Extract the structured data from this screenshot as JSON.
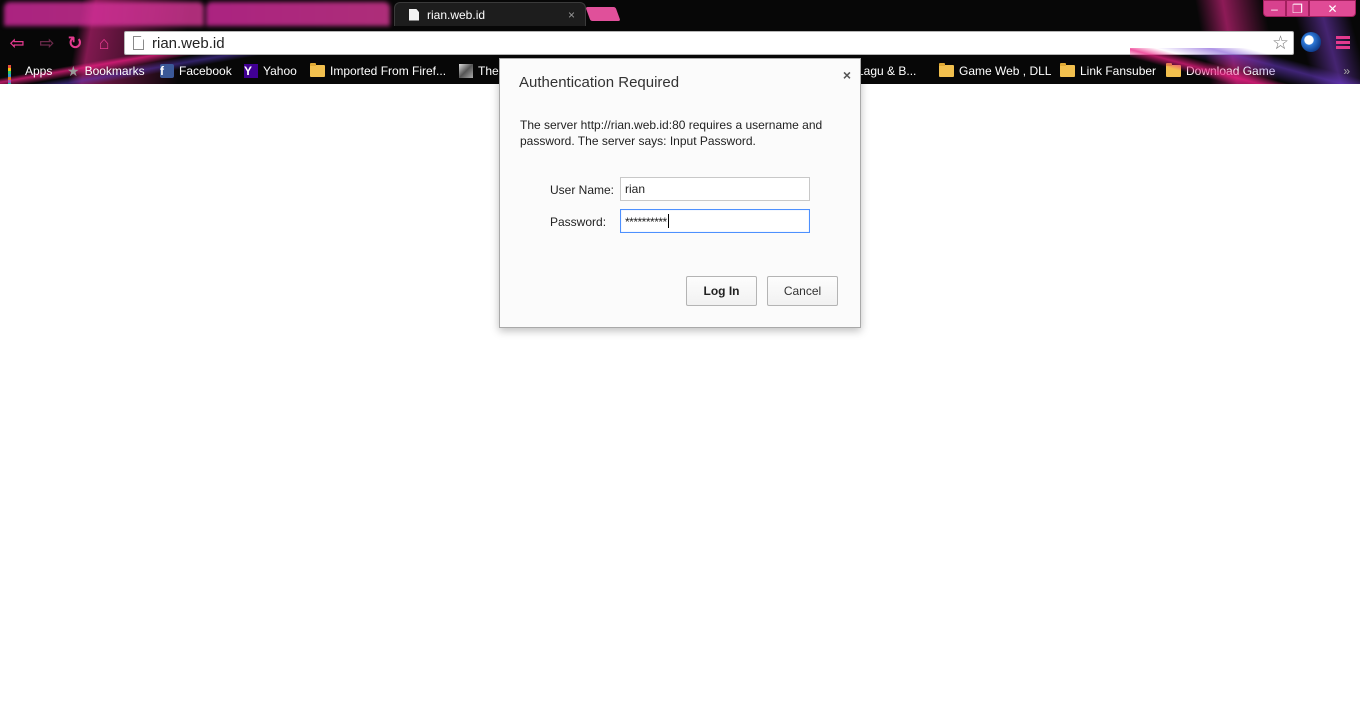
{
  "tabs": [
    {
      "title": "",
      "state": "inactive"
    },
    {
      "title": "",
      "state": "inactive"
    },
    {
      "title": "rian.web.id",
      "state": "active",
      "close": "×"
    }
  ],
  "window_controls": {
    "minimize": "‒",
    "maximize": "❐",
    "close": "✕"
  },
  "toolbar": {
    "back": "⇦",
    "forward": "⇨",
    "reload": "↻",
    "home": "⌂",
    "url": "rian.web.id",
    "bookmark_star": "☆"
  },
  "bookmarks": {
    "items": [
      {
        "label": "Apps",
        "icon": "apps-grid-icon"
      },
      {
        "label": "Bookmarks",
        "icon": "star-icon"
      },
      {
        "label": "Facebook",
        "icon": "facebook-icon",
        "glyph": "f"
      },
      {
        "label": "Yahoo",
        "icon": "yahoo-icon",
        "glyph": "Y"
      },
      {
        "label": "Imported From Firef...",
        "icon": "folder-icon"
      },
      {
        "label": "The",
        "icon": "image-icon"
      },
      {
        "label": "d Lagu & B...",
        "icon": "folder-icon"
      },
      {
        "label": "Game Web , DLL",
        "icon": "folder-icon"
      },
      {
        "label": "Link Fansuber",
        "icon": "folder-icon"
      },
      {
        "label": "Download Game",
        "icon": "folder-icon"
      }
    ],
    "overflow": "»"
  },
  "dialog": {
    "title": "Authentication Required",
    "close": "×",
    "message": "The server http://rian.web.id:80 requires a username and password. The server says: Input Password.",
    "username_label": "User Name:",
    "username_value": "rian",
    "password_label": "Password:",
    "password_value": "**********",
    "login_label": "Log In",
    "cancel_label": "Cancel"
  },
  "colors": {
    "accent_pink": "#e33a8e",
    "frame_dark": "#070707",
    "focus_blue": "#4d90fe"
  }
}
